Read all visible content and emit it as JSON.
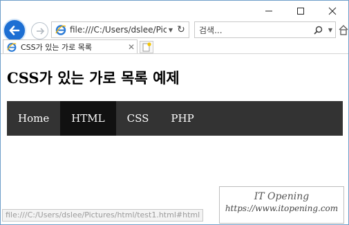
{
  "browser": {
    "address_url": "file:///C:/Users/dslee/Pictu",
    "search_placeholder": "검색...",
    "tab_title": "CSS가 있는 가로 목록",
    "status_url": "file:///C:/Users/dslee/Pictures/html/test1.html#html"
  },
  "page": {
    "heading": "CSS가 있는 가로 목록 예제",
    "menu": [
      {
        "label": "Home"
      },
      {
        "label": "HTML"
      },
      {
        "label": "CSS"
      },
      {
        "label": "PHP"
      }
    ],
    "active_menu": "HTML"
  },
  "watermark": {
    "name": "IT Opening",
    "url": "https://www.itopening.com"
  },
  "colors": {
    "menu_bg": "#333333",
    "menu_active_bg": "#111111",
    "back_button": "#1d6fd3"
  }
}
